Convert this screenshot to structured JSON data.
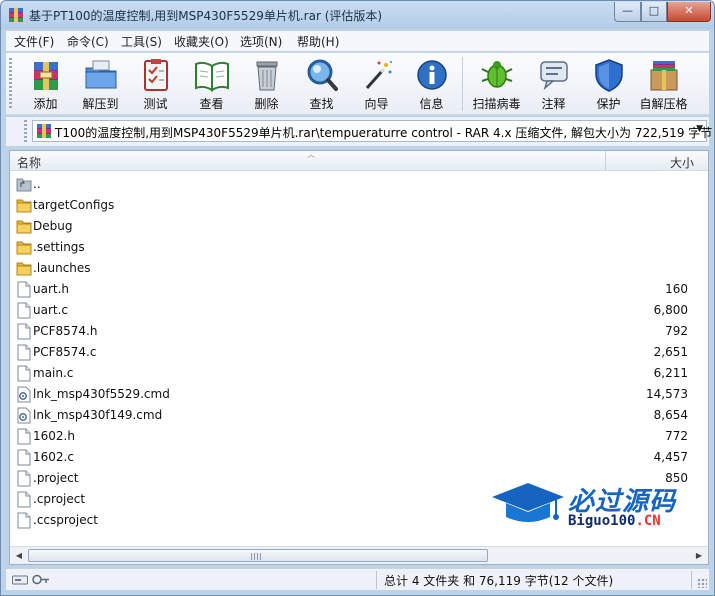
{
  "window": {
    "title": "基于PT100的温度控制,用到MSP430F5529单片机.rar (评估版本)",
    "controls": {
      "minimize": "—",
      "maximize": "□",
      "close": "✕"
    }
  },
  "menu": [
    "文件(F)",
    "命令(C)",
    "工具(S)",
    "收藏夹(O)",
    "选项(N)",
    "帮助(H)"
  ],
  "toolbar": [
    {
      "label": "添加",
      "icon": "add-archive-icon"
    },
    {
      "label": "解压到",
      "icon": "extract-folder-icon"
    },
    {
      "label": "测试",
      "icon": "test-checklist-icon"
    },
    {
      "label": "查看",
      "icon": "view-book-icon"
    },
    {
      "label": "删除",
      "icon": "trash-icon"
    },
    {
      "label": "查找",
      "icon": "magnifier-icon"
    },
    {
      "label": "向导",
      "icon": "wizard-wand-icon"
    },
    {
      "label": "信息",
      "icon": "info-icon"
    },
    {
      "label": "扫描病毒",
      "icon": "virus-scan-icon"
    },
    {
      "label": "注释",
      "icon": "comment-icon"
    },
    {
      "label": "保护",
      "icon": "shield-icon"
    },
    {
      "label": "自解压格",
      "icon": "sfx-box-icon"
    }
  ],
  "address": {
    "path": "T100的温度控制,用到MSP430F5529单片机.rar\\tempueraturre control - RAR 4.x 压缩文件, 解包大小为 722,519 字节"
  },
  "columns": {
    "name": "名称",
    "size": "大小"
  },
  "files": [
    {
      "name": "..",
      "size": "",
      "type": "parent"
    },
    {
      "name": "targetConfigs",
      "size": "",
      "type": "folder"
    },
    {
      "name": "Debug",
      "size": "",
      "type": "folder"
    },
    {
      "name": ".settings",
      "size": "",
      "type": "folder"
    },
    {
      "name": ".launches",
      "size": "",
      "type": "folder"
    },
    {
      "name": "uart.h",
      "size": "160",
      "type": "file"
    },
    {
      "name": "uart.c",
      "size": "6,800",
      "type": "file"
    },
    {
      "name": "PCF8574.h",
      "size": "792",
      "type": "file"
    },
    {
      "name": "PCF8574.c",
      "size": "2,651",
      "type": "file"
    },
    {
      "name": "main.c",
      "size": "6,211",
      "type": "file"
    },
    {
      "name": "lnk_msp430f5529.cmd",
      "size": "14,573",
      "type": "cmd"
    },
    {
      "name": "lnk_msp430f149.cmd",
      "size": "8,654",
      "type": "cmd"
    },
    {
      "name": "1602.h",
      "size": "772",
      "type": "file"
    },
    {
      "name": "1602.c",
      "size": "4,457",
      "type": "file"
    },
    {
      "name": ".project",
      "size": "850",
      "type": "file"
    },
    {
      "name": ".cproject",
      "size": "",
      "type": "file"
    },
    {
      "name": ".ccsproject",
      "size": "",
      "type": "file"
    }
  ],
  "watermark": {
    "cn": "必过源码",
    "en_main": "Biguo100",
    "en_suffix": ".CN"
  },
  "status": {
    "summary": "总计 4 文件夹 和 76,119 字节(12 个文件)"
  }
}
